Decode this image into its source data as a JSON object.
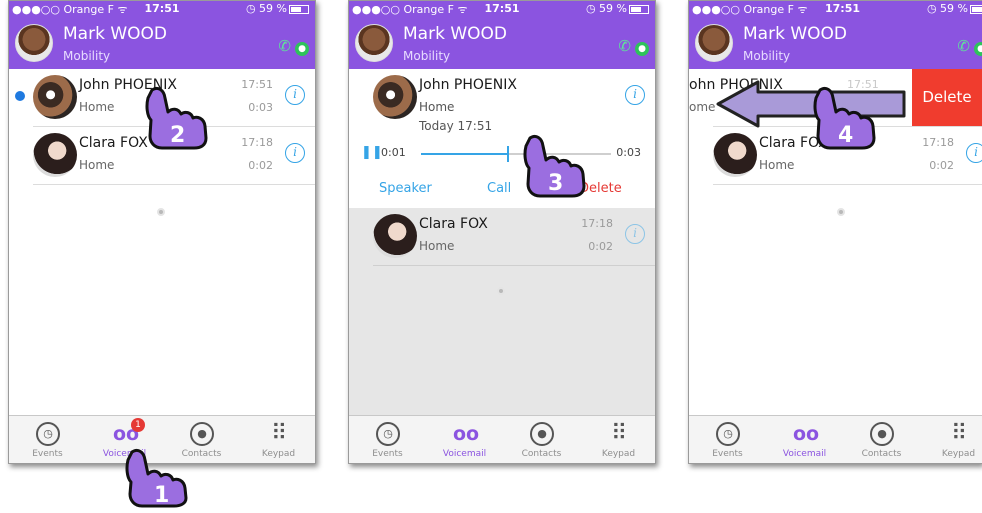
{
  "statusbar": {
    "carrier": "●●●○○ Orange F ᯤ",
    "time": "17:51",
    "battery": "◷ 59 %"
  },
  "header": {
    "name": "Mark WOOD",
    "subtitle": "Mobility"
  },
  "icons": {
    "info": "i",
    "lock": "🔒",
    "phone_wifi": "📞",
    "pause": "❚❚"
  },
  "voicemails": [
    {
      "name": "John PHOENIX",
      "label": "Home",
      "time": "17:51",
      "duration": "0:03"
    },
    {
      "name": "Clara FOX",
      "label": "Home",
      "time": "17:18",
      "duration": "0:02"
    }
  ],
  "expanded": {
    "date": "Today 17:51",
    "current": "0:01",
    "total": "0:03",
    "progress": 0.45
  },
  "actions": {
    "speaker": "Speaker",
    "call": "Call",
    "delete": "Delete"
  },
  "swipe": {
    "delete_label": "Delete",
    "name_partial": "ohn PHOENIX",
    "label_partial": "ome"
  },
  "tabs": [
    {
      "label": "Events",
      "icon": "clock-icon"
    },
    {
      "label": "Voicemail",
      "icon": "voicemail-icon"
    },
    {
      "label": "Contacts",
      "icon": "contacts-icon"
    },
    {
      "label": "Keypad",
      "icon": "keypad-icon"
    }
  ],
  "badge": "1",
  "steps": [
    "1",
    "2",
    "3",
    "4"
  ],
  "colors": {
    "brand": "#8b54e0",
    "accent": "#35a4e6",
    "delete": "#f03c2e",
    "unread": "#1f7ae0"
  }
}
